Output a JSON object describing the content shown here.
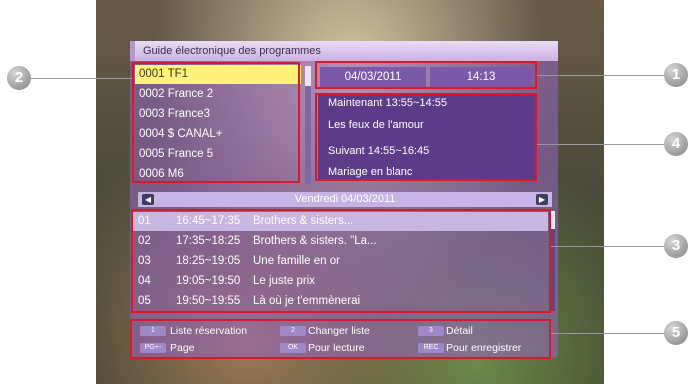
{
  "window": {
    "title": "Guide électronique des programmes"
  },
  "channels": [
    {
      "label": "0001 TF1",
      "selected": true
    },
    {
      "label": "0002 France 2",
      "selected": false
    },
    {
      "label": "0003 France3",
      "selected": false
    },
    {
      "label": "0004 $ CANAL+",
      "selected": false
    },
    {
      "label": "0005 France 5",
      "selected": false
    },
    {
      "label": "0006 M6",
      "selected": false
    }
  ],
  "datetime": {
    "date": "04/03/2011",
    "time": "14:13"
  },
  "info": {
    "now_label": "Maintenant 13:55~14:55",
    "now_title": "Les feux de l'amour",
    "next_label": "Suivant 14:55~16:45",
    "next_title": "Mariage en blanc"
  },
  "day_bar": {
    "label": "Vendredi 04/03/2011",
    "prev_icon": "chevron-left-icon",
    "next_icon": "chevron-right-icon"
  },
  "programmes": [
    {
      "num": "01",
      "time": "16:45~17:35",
      "title": "Brothers & sisters...",
      "selected": true
    },
    {
      "num": "02",
      "time": "17:35~18:25",
      "title": "Brothers & sisters. \"La...",
      "selected": false
    },
    {
      "num": "03",
      "time": "18:25~19:05",
      "title": "Une famille en or",
      "selected": false
    },
    {
      "num": "04",
      "time": "19:05~19:50",
      "title": "Le juste prix",
      "selected": false
    },
    {
      "num": "05",
      "time": "19:50~19:55",
      "title": "Là où je t'emmènerai",
      "selected": false
    }
  ],
  "footer": {
    "key1": "1",
    "key1_label": "Liste réservation",
    "key2": "2",
    "key2_label": "Changer liste",
    "key3": "3",
    "key3_label": "Détail",
    "key_pg": "PG+-",
    "key_pg_label": "Page",
    "key_ok": "OK",
    "key_ok_label": "Pour lecture",
    "key_rec": "REC",
    "key_rec_label": "Pour enregistrer"
  },
  "markers": [
    "1",
    "2",
    "3",
    "4",
    "5"
  ],
  "colors": {
    "callout": "#d9182a",
    "panel": "#8c5fbf",
    "selection": "#fff27a"
  }
}
